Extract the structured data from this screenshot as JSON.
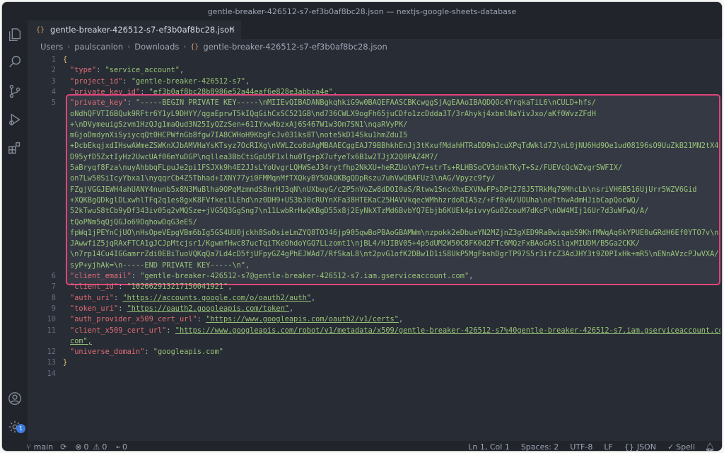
{
  "window": {
    "title": "gentle-breaker-426512-s7-ef3b0af8bc28.json — nextjs-google-sheets-database"
  },
  "tab": {
    "label": "gentle-breaker-426512-s7-ef3b0af8bc28.json",
    "icon_text": "{}"
  },
  "breadcrumb": [
    "Users",
    "paulscanlon",
    "Downloads",
    "gentle-breaker-426512-s7-ef3b0af8bc28.json"
  ],
  "breadcrumb_icon_text": "{}",
  "line_numbers": [
    "1",
    "2",
    "3",
    "4",
    "5",
    "6",
    "7",
    "8",
    "9",
    "10",
    "11",
    "12",
    "13",
    "14"
  ],
  "code": {
    "open_brace": "{",
    "close_brace": "}",
    "lines": [
      {
        "key": "\"type\"",
        "value": "\"service_account\""
      },
      {
        "key": "\"project_id\"",
        "value": "\"gentle-breaker-426512-s7\""
      },
      {
        "key": "\"private_key_id\"",
        "value": "\"ef3b0af8bc28b8986e52a44eaf6e828e3abbca4e\""
      },
      {
        "key": "\"client_id\"",
        "value": "\"102662913217150041921\""
      },
      {
        "key": "\"auth_uri\"",
        "value": "\"https://accounts.google.com/o/oauth2/auth\""
      },
      {
        "key": "\"token_uri\"",
        "value": "\"https://oauth2.googleapis.com/token\""
      },
      {
        "key": "\"auth_provider_x509_cert_url\"",
        "value": "\"https://www.googleapis.com/oauth2/v1/certs\""
      },
      {
        "key": "\"client_x509_cert_url\"",
        "value": "\"https://www.googleapis.com/robot/v1/metadata/x509/gentle-breaker-426512-s7%40gentle-breaker-426512-s7.iam.gserviceaccount.com\""
      },
      {
        "key": "\"universe_domain\"",
        "value": "\"googleapis.com\""
      }
    ],
    "private_key": {
      "key": "\"private_key\"",
      "wrapped_lines": [
        "\"-----BEGIN PRIVATE KEY-----\\nMIIEvQIBADANBgkqhkiG9w0BAQEFAASCBKcwggSjAgEAAoIBAQDQOc4YrqkaTiL6\\nCULD+hfs/",
        "oNdhQFVTI6BQuk9RFtr6Y1yL9DHYY/qgaEprwT5kIQqGihCxSC521GB\\nd736CWLX9ogFh65juCDfo1zcDdda3T/3rAhykj4xbmlNaYivJxo/aKf0WvzZFdH",
        "+\\nDVymeuigSzvm1HzQJg1maQud3N25IyQZzSen+61IYxw4bzxAj6S467W1w3Om7SN1\\nqaRVyPK/",
        "mGjoDmdynXiSyiycqQt0HCPWfnGb8fgw7IA8CWHoH9KbgFcJv031ks8T\\note5kD14Sku1hmZduI5",
        "+DcbEkqjxdIHswAWmeZSWKnXJbAMVHaYsKTsyz7OcRIXg\\nVWLZco8dAgMBAAECggEAJ79BBhkhEnJj3tKxufMdahHTRaDD9mJcuXPqTdWkld7J\\nL0jNU6Hd9Oe1ud08196sO9UuZkB21MN2tX4",
        "D95yfD5ZxtIyHz2UwcUAf06mYuDGP\\nqllea3BbCtiGpU5F1xlhu0Tg+pX7ufyeTx6B1w2TJjX2Q0PAZ4M7/",
        "5aBryqf8Fza\\nuyAhbbqFLpuJe2pi1FSJXk9h4E2JJsLYoUvgrLQHWSeJ34rytfhp2NkXU+heRZUo\\nY7+strTs+RLHBSoCV3dnkTKyT+Sz/FUEVcQcWZvgrSWFIX/",
        "on7Lw50SiIcyYbxa1\\nyqqrCb4Z5Tbhad+IXNY77yi0FMMqnMfTXQkyBY5OAQKBgQDpRszu7uhVwQBAFUz3\\nAG/Vpyzc9fy/",
        "FZgjVGGJEWH4ahUANY4nunb5x8N3MuBlha9OPqMzmndS8nrHJ3qN\\nUXbuyG/c2P5nVoZw8dDOI0aS/Rtww1SncXhxEXVNwFPsDPt278J5TRkMq79MhcLb\\nsriVH6B516UjUrr5WZV6Gid",
        "+XQKBgQDkglDLxwhlTFq2q1es8gxK8FVfkeilLEhd\\nz0DH9+US3b30cRUYnXFa38HTEKaC25HAVVkqecWMhhzrdoRIA5z/+Ff8vH/UOUha\\neTthwAdmHJibCapQocWQ/",
        "52kTwuS8tCb9yDf343iv05q2vMQSze+jVG5Q3GgSng7\\n11LwbRrHwQKBgD55x8j2EyNkXTzMd6BvbYQ7Ebjb6KUEk4pivvyGu0ZcouM7dKcP\\nOW4MIj16Ur7d3uWFwQ/A/",
        "tQoPNm5qQjQGJo69DqhowDqG3eES/",
        "fpWq1jPEYnCjUO\\nHsOpeVEpgVBm6bIg5GS4UU0jckh8SoOsieLmZYQ8TO346jp905qwBoPBAoGBAMWm\\nzpokk2eDbueYN2MZjnZ3gXED9RaBwiqabS9KhfMWqAq6kYPUE0uGRdH6Ef0YTO7v\\n",
        "JAwwfiZ5jqRAxFTCA1gJCJpMtcjsr1/KgwmfHwc87ucTqiTKeOhdoYGQ7LLzomt1\\njBL4/HJIBV05+4p5dUM2W50C8FK0d2FTc6MQzFxBAoGASilqxMIUDM/B5Ga2CKK/",
        "\\n7rp14Cu4IGGamrrZdi0EBiTuoVQKqQa7Ld4cD5fjUFpyGZ4gPhEJWAd7/RfSkaL8\\nt2pvG1ofK2DBw1D1iS8UkP5MgFbshDgrTP97S5r3ifcZ3AdJHY3t9Z0PIxHk+mR5\\nENnAVzcPJwVXA/",
        "syP+yjhAk=\\n-----END PRIVATE KEY-----\\n\","
      ]
    },
    "client_email": {
      "key": "\"client_email\"",
      "value": "\"gentle-breaker-426512-s7@gentle-breaker-426512-s7.iam.gserviceaccount.com\""
    },
    "url_continuation": "com\","
  },
  "status": {
    "branch": "main",
    "errors": "0",
    "warnings": "0",
    "ports": "0",
    "position": "Ln 1, Col 1",
    "spaces": "Spaces: 2",
    "encoding": "UTF-8",
    "eol": "LF",
    "language": "JSON",
    "spell": "Spell"
  },
  "activity": {
    "badge": "1"
  },
  "colors": {
    "highlight_border": "#e0457b",
    "key": "#e06c75",
    "string": "#98c379",
    "background": "#282c34"
  }
}
